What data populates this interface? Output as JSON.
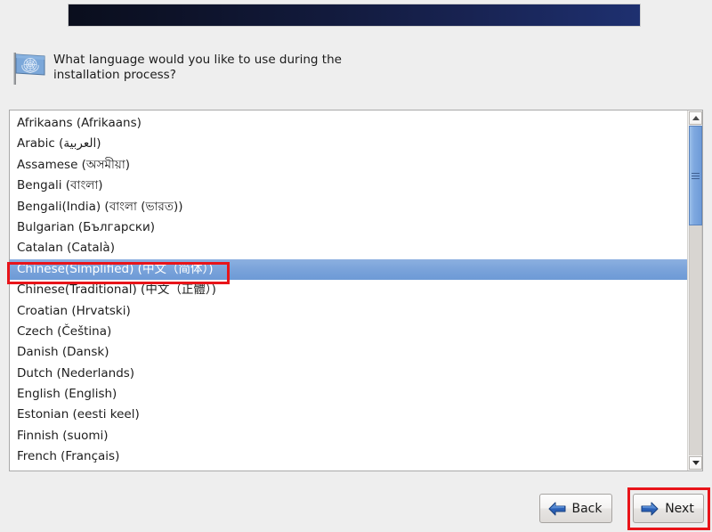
{
  "window": {
    "background_color": "#eeeeee",
    "banner": {
      "name": "installer-banner",
      "gradient_from": "#0a0e1d",
      "gradient_to": "#1e3070"
    }
  },
  "prompt": {
    "icon": "flag-icon",
    "text": "What language would you like to use during the installation process?"
  },
  "language_list": {
    "name": "language-listbox",
    "selected_index": 7,
    "items": [
      "Afrikaans (Afrikaans)",
      "Arabic (العربية)",
      "Assamese (অসমীয়া)",
      "Bengali (বাংলা)",
      "Bengali(India) (বাংলা (ভারত))",
      "Bulgarian (Български)",
      "Catalan (Català)",
      "Chinese(Simplified) (中文（简体）)",
      "Chinese(Traditional) (中文（正體）)",
      "Croatian (Hrvatski)",
      "Czech (Čeština)",
      "Danish (Dansk)",
      "Dutch (Nederlands)",
      "English (English)",
      "Estonian (eesti keel)",
      "Finnish (suomi)",
      "French (Français)"
    ]
  },
  "scrollbar": {
    "up_arrow_icon": "chevron-up-icon",
    "down_arrow_icon": "chevron-down-icon",
    "thumb_color": "#7fa9e0"
  },
  "footer": {
    "back_label": "Back",
    "back_icon": "arrow-left-icon",
    "next_label": "Next",
    "next_icon": "arrow-right-icon"
  },
  "annotations": {
    "highlight_color": "#e8141a",
    "selected_row_target": "Chinese(Simplified) (中文（简体）)",
    "button_target": "Next"
  }
}
